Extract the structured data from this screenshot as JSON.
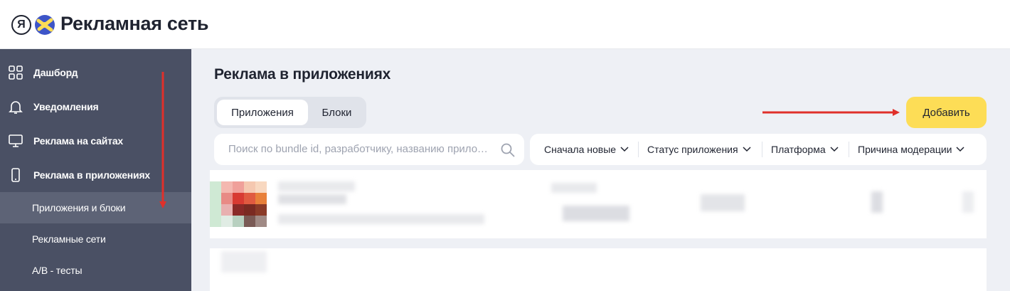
{
  "header": {
    "logo_letter": "Я",
    "title": "Рекламная сеть"
  },
  "sidebar": {
    "items": [
      {
        "label": "Дашборд",
        "icon": "dashboard-grid-icon"
      },
      {
        "label": "Уведомления",
        "icon": "bell-icon"
      },
      {
        "label": "Реклама на сайтах",
        "icon": "monitor-icon"
      },
      {
        "label": "Реклама в приложениях",
        "icon": "phone-icon"
      }
    ],
    "subitems": [
      {
        "label": "Приложения и блоки",
        "active": true
      },
      {
        "label": "Рекламные сети",
        "active": false
      },
      {
        "label": "A/B - тесты",
        "active": false
      }
    ]
  },
  "main": {
    "title": "Реклама в приложениях",
    "tabs": [
      {
        "label": "Приложения",
        "active": true
      },
      {
        "label": "Блоки",
        "active": false
      }
    ],
    "add_button": "Добавить",
    "search": {
      "placeholder": "Поиск по bundle id, разработчику, названию приложения"
    },
    "filters": [
      {
        "label": "Сначала новые"
      },
      {
        "label": "Статус приложения"
      },
      {
        "label": "Платформа"
      },
      {
        "label": "Причина модерации"
      }
    ]
  },
  "colors": {
    "sidebar_bg": "#4a5064",
    "sidebar_active": "#5d6376",
    "main_bg": "#eef0f5",
    "accent_button": "#fddd56",
    "annotation_arrow": "#e0302a"
  }
}
